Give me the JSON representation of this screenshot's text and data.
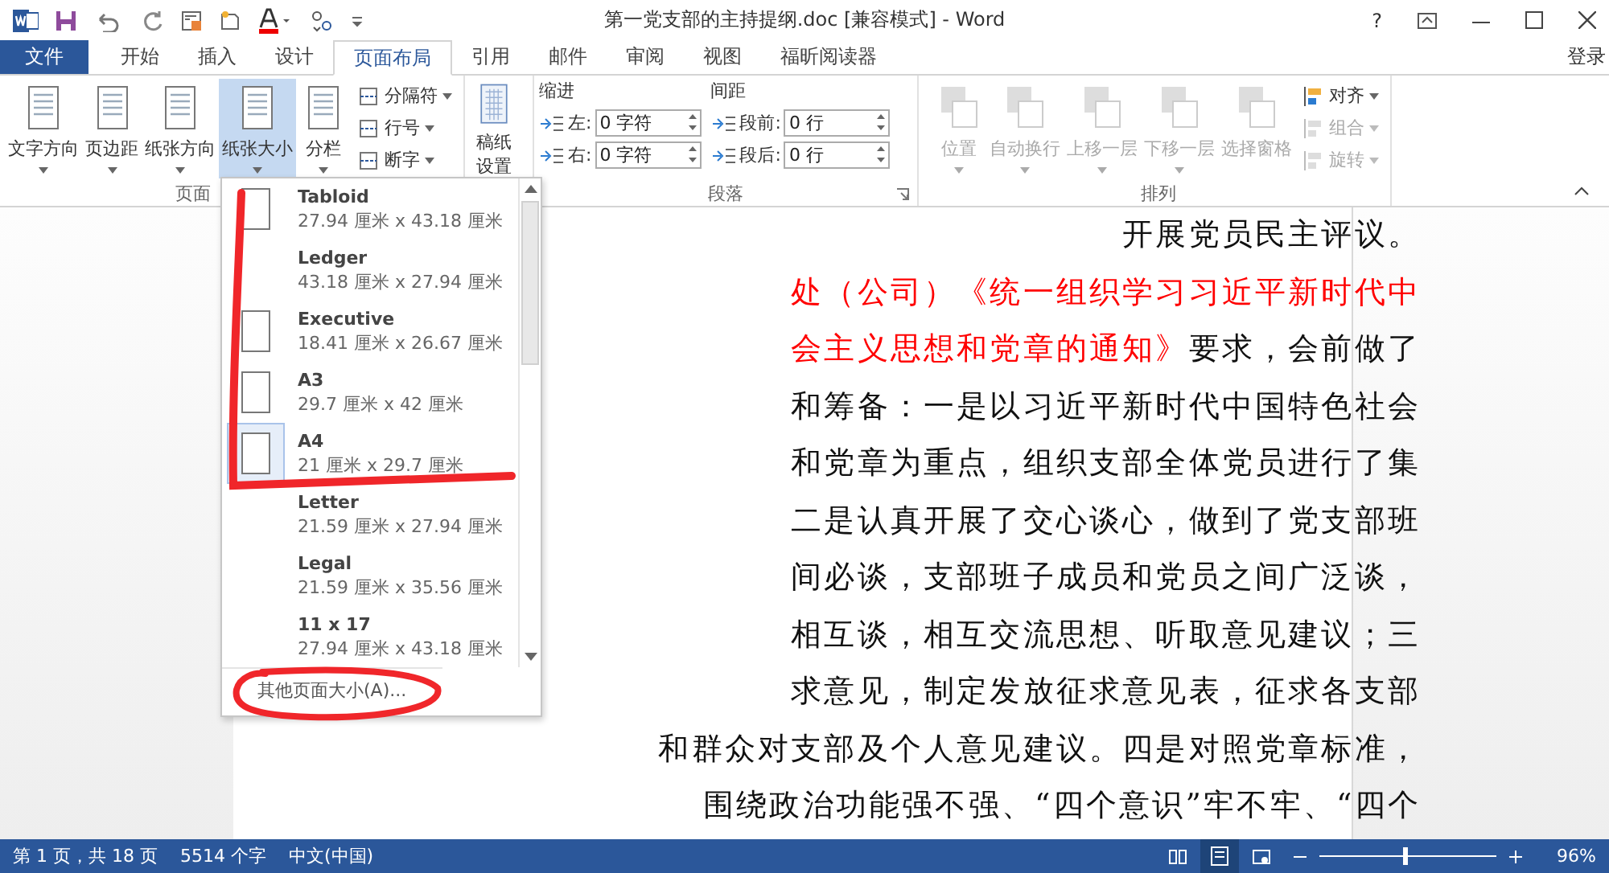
{
  "title_bar": {
    "title": "第一党支部的主持提纲.doc [兼容模式] - Word",
    "help": "?"
  },
  "ribbon_tabs": {
    "file_tab": "文件",
    "sign_in": "登录",
    "tabs": [
      {
        "label": "开始",
        "selected": false
      },
      {
        "label": "插入",
        "selected": false
      },
      {
        "label": "设计",
        "selected": false
      },
      {
        "label": "页面布局",
        "selected": true
      },
      {
        "label": "引用",
        "selected": false
      },
      {
        "label": "邮件",
        "selected": false
      },
      {
        "label": "审阅",
        "selected": false
      },
      {
        "label": "视图",
        "selected": false
      },
      {
        "label": "福昕阅读器",
        "selected": false
      }
    ]
  },
  "page_setup": {
    "label": "页面",
    "large_buttons": [
      {
        "label": "文字方向",
        "selected": false
      },
      {
        "label": "页边距",
        "selected": false
      },
      {
        "label": "纸张方向",
        "selected": false
      },
      {
        "label": "纸张大小",
        "selected": true
      },
      {
        "label": "分栏",
        "selected": false
      }
    ],
    "small_buttons": [
      "分隔符",
      "行号",
      "断字"
    ]
  },
  "manuscript": {
    "label": "稿纸设置"
  },
  "paragraph": {
    "label": "段落",
    "indent": {
      "heading": "缩进",
      "fields": [
        {
          "label": "左:",
          "value": "0 字符"
        },
        {
          "label": "右:",
          "value": "0 字符"
        }
      ]
    },
    "spacing": {
      "heading": "间距",
      "fields": [
        {
          "label": "段前:",
          "value": "0 行"
        },
        {
          "label": "段后:",
          "value": "0 行"
        }
      ]
    }
  },
  "arrange": {
    "label": "排列",
    "large_buttons": [
      {
        "label": "位置",
        "disabled": true,
        "dropdown": true
      },
      {
        "label": "自动换行",
        "disabled": true,
        "dropdown": true
      },
      {
        "label": "上移一层",
        "disabled": true,
        "dropdown": true
      },
      {
        "label": "下移一层",
        "disabled": true,
        "dropdown": true
      },
      {
        "label": "选择窗格",
        "disabled": true,
        "dropdown": false
      }
    ],
    "small_buttons": [
      {
        "label": "对齐",
        "disabled": false
      },
      {
        "label": "组合",
        "disabled": true
      },
      {
        "label": "旋转",
        "disabled": true
      }
    ]
  },
  "paper_menu": {
    "items": [
      {
        "name": "Tabloid",
        "size": "27.94 厘米 x 43.18 厘米",
        "kind": "preview",
        "selected": false
      },
      {
        "name": "Ledger",
        "size": "43.18 厘米 x 27.94 厘米",
        "kind": "plain",
        "selected": false
      },
      {
        "name": "Executive",
        "size": "18.41 厘米 x 26.67 厘米",
        "kind": "preview",
        "selected": false
      },
      {
        "name": "A3",
        "size": "29.7 厘米 x 42 厘米",
        "kind": "preview",
        "selected": false
      },
      {
        "name": "A4",
        "size": "21 厘米 x 29.7 厘米",
        "kind": "preview",
        "selected": true
      },
      {
        "name": "Letter",
        "size": "21.59 厘米 x 27.94 厘米",
        "kind": "plain",
        "selected": false
      },
      {
        "name": "Legal",
        "size": "21.59 厘米 x 35.56 厘米",
        "kind": "plain",
        "selected": false
      },
      {
        "name": "11 x 17",
        "size": "27.94 厘米 x 43.18 厘米",
        "kind": "plain",
        "selected": false
      }
    ],
    "more": "其他页面大小(A)..."
  },
  "document": {
    "lines": [
      {
        "runs": [
          {
            "text": "开展党员民主评议。",
            "kind": "plain"
          }
        ]
      },
      {
        "runs": [
          {
            "text": "处（公司）《统一组织学习习近平新时代中",
            "kind": "red"
          }
        ]
      },
      {
        "runs": [
          {
            "text": "会主义思想和党章的通知》",
            "kind": "red"
          },
          {
            "text": "要求，会前做了",
            "kind": "plain"
          }
        ]
      },
      {
        "runs": [
          {
            "text": "和筹备：一是以习近平新时代中国特色社会",
            "kind": "plain"
          }
        ]
      },
      {
        "runs": [
          {
            "text": "和党章为重点，组织支部全体党员进行了集",
            "kind": "plain"
          }
        ]
      },
      {
        "runs": [
          {
            "text": "二是认真开展了交心谈心，做到了党支部班",
            "kind": "plain"
          }
        ]
      },
      {
        "runs": [
          {
            "text": "间必谈，支部班子成员和党员之间广泛谈，",
            "kind": "plain"
          }
        ]
      },
      {
        "runs": [
          {
            "text": "相互谈，相互交流思想、听取意见建议；三",
            "kind": "plain"
          }
        ]
      },
      {
        "runs": [
          {
            "text": "求意见，制定发放征求意见表，征求各支部",
            "kind": "plain"
          }
        ]
      },
      {
        "runs": [
          {
            "text": "和群众对支部及个人意见建议。四是对照党章标准，",
            "kind": "plain"
          }
        ]
      },
      {
        "runs": [
          {
            "text": "围绕政治功能强不强、“四个意识”牢不牢、“四个",
            "kind": "plain"
          }
        ]
      }
    ]
  },
  "status_bar": {
    "page": "第 1 页，共 18 页",
    "words": "5514 个字",
    "language": "中文(中国)",
    "zoom": {
      "level": 0.48,
      "percent": "96%"
    }
  }
}
